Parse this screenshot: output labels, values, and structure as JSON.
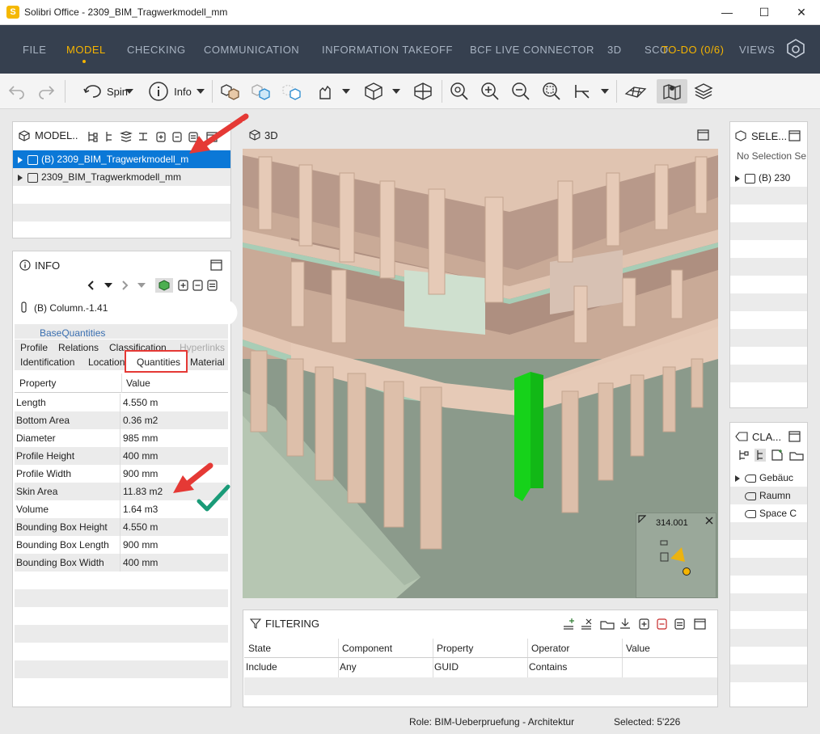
{
  "window": {
    "logo_letter": "S",
    "title": "Solibri Office - 2309_BIM_Tragwerkmodell_mm",
    "minimize": "—",
    "maximize": "☐",
    "close": "✕"
  },
  "menu": {
    "items": [
      "FILE",
      "MODEL",
      "CHECKING",
      "COMMUNICATION",
      "INFORMATION TAKEOFF",
      "BCF LIVE CONNECTOR",
      "3D",
      "SCO"
    ],
    "active": "MODEL",
    "overlay": "TO-DO (0/6)",
    "views": "VIEWS"
  },
  "toolbar": {
    "spin_label": "Spin",
    "info_label": "Info"
  },
  "model_panel": {
    "title": "MODEL..",
    "rows": [
      {
        "label": "(B) 2309_BIM_Tragwerkmodell_m",
        "selected": true
      },
      {
        "label": "2309_BIM_Tragwerkmodell_mm",
        "selected": false
      }
    ]
  },
  "info_panel": {
    "title": "INFO",
    "element": "(B) Column.-1.41",
    "tabs_row1": [
      "BaseQuantities"
    ],
    "tabs_row2": [
      "Profile",
      "Relations",
      "Classification",
      "Hyperlinks"
    ],
    "tabs_row3": [
      "Identification",
      "Location",
      "Quantities",
      "Material"
    ],
    "table_header": {
      "property": "Property",
      "value": "Value"
    },
    "properties": [
      {
        "name": "Length",
        "value": "4.550 m"
      },
      {
        "name": "Bottom Area",
        "value": "0.36 m2"
      },
      {
        "name": "Diameter",
        "value": "985 mm"
      },
      {
        "name": "Profile Height",
        "value": "400 mm"
      },
      {
        "name": "Profile Width",
        "value": "900 mm"
      },
      {
        "name": "Skin Area",
        "value": "11.83 m2"
      },
      {
        "name": "Volume",
        "value": "1.64 m3"
      },
      {
        "name": "Bounding Box Height",
        "value": "4.550 m"
      },
      {
        "name": "Bounding Box Length",
        "value": "900 mm"
      },
      {
        "name": "Bounding Box Width",
        "value": "400 mm"
      }
    ]
  },
  "view3d": {
    "title": "3D",
    "minimap_label": "314.001"
  },
  "selection_panel": {
    "title": "SELE...",
    "empty_text": "No Selection Se",
    "row": "(B) 230"
  },
  "classification_panel": {
    "title": "CLA...",
    "rows": [
      "Gebäuc",
      "Raumn",
      "Space C"
    ]
  },
  "filtering_panel": {
    "title": "FILTERING",
    "headers": [
      "State",
      "Component",
      "Property",
      "Operator",
      "Value"
    ],
    "rows": [
      [
        "Include",
        "Any",
        "GUID",
        "Contains",
        ""
      ]
    ]
  },
  "status": {
    "role": "Role: BIM-Ueberpruefung - Architektur",
    "selected": "Selected: 5'226"
  },
  "colors": {
    "menubar": "#36404f",
    "accent": "#f5b400",
    "selection": "#0b78d7",
    "highlight_column": "#16d21a",
    "annotation_red": "#e53935",
    "annotation_check": "#1a9b78"
  }
}
